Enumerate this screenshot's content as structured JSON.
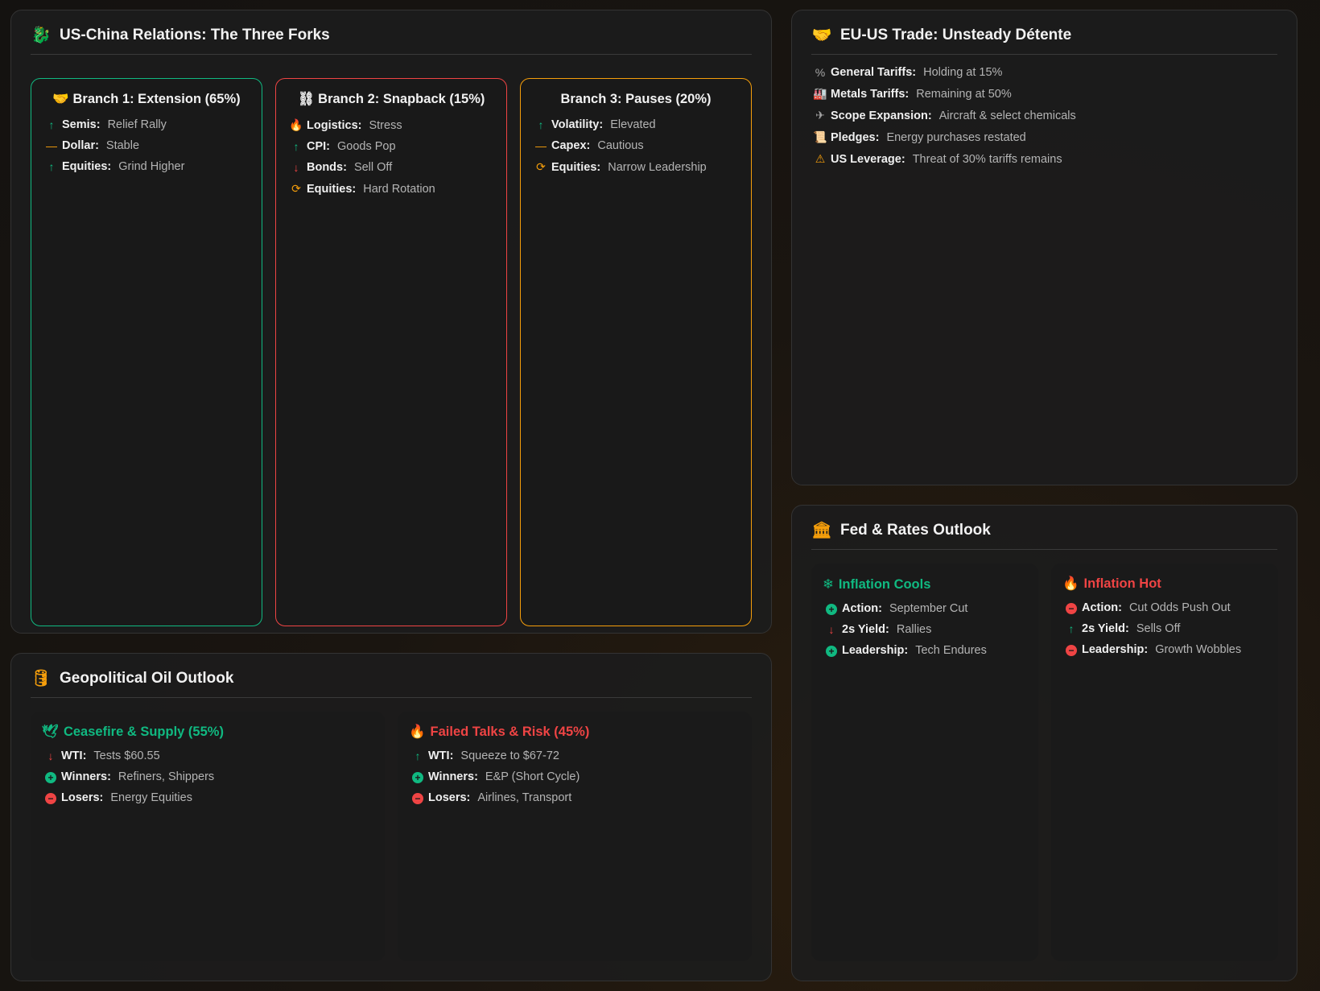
{
  "us_china": {
    "title": "US-China Relations: The Three Forks",
    "branches": [
      {
        "title": "Branch 1: Extension (65%)",
        "icon": "handshake-icon",
        "color": "#10b981",
        "items": [
          {
            "icon": "arrow-up-icon",
            "label": "Semis:",
            "value": "Relief Rally"
          },
          {
            "icon": "dash-icon",
            "label": "Dollar:",
            "value": "Stable"
          },
          {
            "icon": "arrow-up-icon",
            "label": "Equities:",
            "value": "Grind Higher"
          }
        ]
      },
      {
        "title": "Branch 2: Snapback (15%)",
        "icon": "broken-link-icon",
        "color": "#ef4444",
        "items": [
          {
            "icon": "fire-icon",
            "label": "Logistics:",
            "value": "Stress"
          },
          {
            "icon": "arrow-up-icon",
            "label": "CPI:",
            "value": "Goods Pop"
          },
          {
            "icon": "arrow-down-icon",
            "label": "Bonds:",
            "value": "Sell Off"
          },
          {
            "icon": "rotate-icon",
            "label": "Equities:",
            "value": "Hard Rotation"
          }
        ]
      },
      {
        "title": "Branch 3: Pauses (20%)",
        "color": "#f59e0b",
        "items": [
          {
            "icon": "arrow-up-icon",
            "label": "Volatility:",
            "value": "Elevated"
          },
          {
            "icon": "dash-icon",
            "label": "Capex:",
            "value": "Cautious"
          },
          {
            "icon": "rotate-icon",
            "label": "Equities:",
            "value": "Narrow Leadership"
          }
        ]
      }
    ]
  },
  "eu_us": {
    "title": "EU-US Trade: Unsteady Détente",
    "items": [
      {
        "icon": "percent-icon",
        "label": "General Tariffs:",
        "value": "Holding at 15%"
      },
      {
        "icon": "factory-icon",
        "label": "Metals Tariffs:",
        "value": "Remaining at 50%"
      },
      {
        "icon": "plane-icon",
        "label": "Scope Expansion:",
        "value": "Aircraft & select chemicals"
      },
      {
        "icon": "scroll-icon",
        "label": "Pledges:",
        "value": "Energy purchases restated"
      },
      {
        "icon": "warning-icon",
        "label": "US Leverage:",
        "value": "Threat of 30% tariffs remains"
      }
    ]
  },
  "oil": {
    "title": "Geopolitical Oil Outlook",
    "scenarios": [
      {
        "title": "Ceasefire & Supply (55%)",
        "items": [
          {
            "icon": "arrow-down-icon",
            "label": "WTI:",
            "value": "Tests $60.55"
          },
          {
            "icon": "plus-circle-icon",
            "label": "Winners:",
            "value": "Refiners, Shippers"
          },
          {
            "icon": "minus-circle-icon",
            "label": "Losers:",
            "value": "Energy Equities"
          }
        ]
      },
      {
        "title": "Failed Talks & Risk (45%)",
        "items": [
          {
            "icon": "arrow-up-icon",
            "label": "WTI:",
            "value": "Squeeze to $67-72"
          },
          {
            "icon": "plus-circle-icon",
            "label": "Winners:",
            "value": "E&P (Short Cycle)"
          },
          {
            "icon": "minus-circle-icon",
            "label": "Losers:",
            "value": "Airlines, Transport"
          }
        ]
      }
    ]
  },
  "fed": {
    "title": "Fed & Rates Outlook",
    "scenarios": [
      {
        "title": "Inflation Cools",
        "items": [
          {
            "icon": "plus-circle-icon",
            "label": "Action:",
            "value": "September Cut"
          },
          {
            "icon": "arrow-down-icon",
            "label": "2s Yield:",
            "value": "Rallies"
          },
          {
            "icon": "plus-circle-icon",
            "label": "Leadership:",
            "value": "Tech Endures"
          }
        ]
      },
      {
        "title": "Inflation Hot",
        "items": [
          {
            "icon": "minus-circle-icon",
            "label": "Action:",
            "value": "Cut Odds Push Out"
          },
          {
            "icon": "arrow-up-icon",
            "label": "2s Yield:",
            "value": "Sells Off"
          },
          {
            "icon": "minus-circle-icon",
            "label": "Leadership:",
            "value": "Growth Wobbles"
          }
        ]
      }
    ]
  },
  "colors": {
    "accent": "#f59e0b",
    "positive": "#10b981",
    "negative": "#ef4444"
  }
}
